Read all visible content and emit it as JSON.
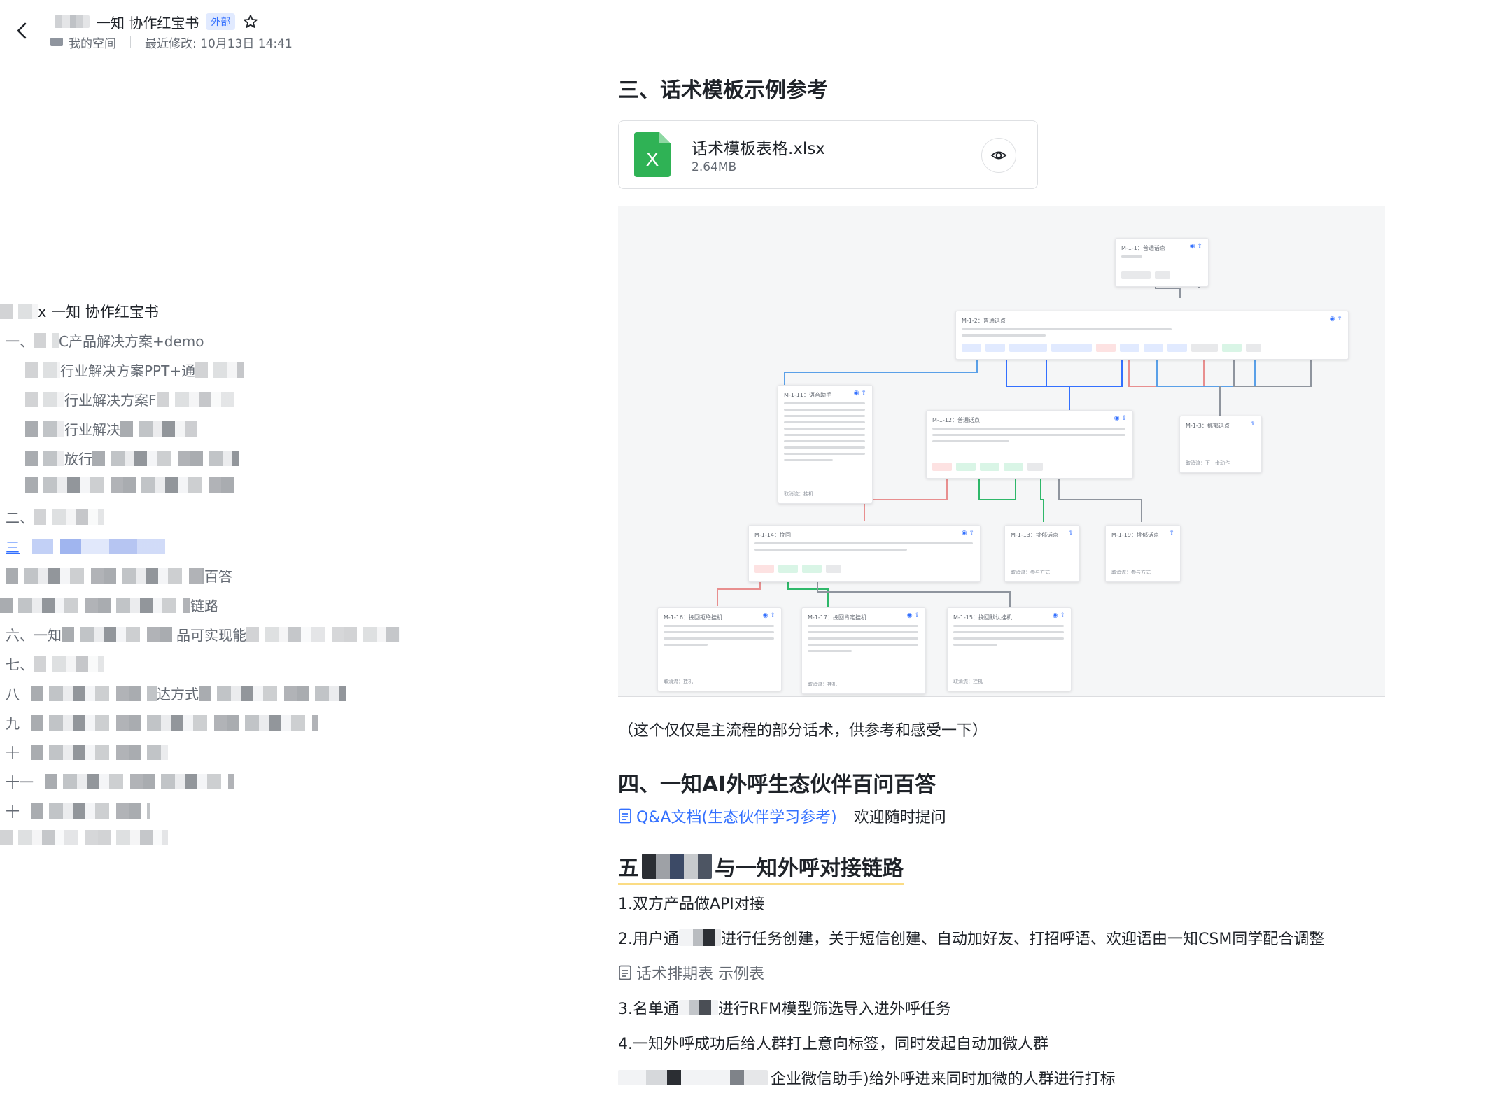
{
  "header": {
    "title": "一知 协作红宝书",
    "badge": "外部",
    "space": "我的空间",
    "modified": "最近修改: 10月13日 14:41"
  },
  "outline": {
    "title": "x 一知 协作红宝书",
    "items": [
      {
        "text": "一、"
      },
      {
        "text": "C产品解决方案+demo"
      },
      {
        "text": "行业解决方案PPT+通"
      },
      {
        "text": "行业解决方案F"
      },
      {
        "text": "行业解决"
      },
      {
        "text": "放行"
      },
      {
        "text": "二、"
      },
      {
        "text": "三"
      },
      {
        "text": "百答"
      },
      {
        "text": "链路"
      },
      {
        "text": "六、一知"
      },
      {
        "text": "品可实现能"
      },
      {
        "text": "七、"
      },
      {
        "text": "八"
      },
      {
        "text": "达方式"
      },
      {
        "text": "九"
      },
      {
        "text": "十"
      },
      {
        "text": "十一"
      },
      {
        "text": "十"
      }
    ]
  },
  "doc": {
    "section3_title": "三、话术模板示例参考",
    "file": {
      "name": "话术模板表格.xlsx",
      "size": "2.64MB",
      "icon_letter": "X"
    },
    "flow_nodes": [
      {
        "title": "M-1-1：普通话点",
        "foot": ""
      },
      {
        "title": "M-1-2：普通话点",
        "foot": ""
      },
      {
        "title": "M-1-11：语音助手",
        "foot": "取消流：挂机"
      },
      {
        "title": "M-1-12：普通话点",
        "foot": ""
      },
      {
        "title": "M-1-3：挑郁话点",
        "foot": "取消流：下一步动作"
      },
      {
        "title": "M-1-14：挽回",
        "foot": ""
      },
      {
        "title": "M-1-13：挑郁话点",
        "foot": "取消流：参与方式"
      },
      {
        "title": "M-1-19：挑郁话点",
        "foot": "取消流：参与方式"
      },
      {
        "title": "M-1-16：挽回拒绝挂机",
        "foot": "取消流：挂机"
      },
      {
        "title": "M-1-17：挽回肯定挂机",
        "foot": "取消流：挂机"
      },
      {
        "title": "M-1-15：挽回默认挂机",
        "foot": "取消流：挂机"
      }
    ],
    "flow_caption": "（这个仅仅是主流程的部分话术，供参考和感受一下）",
    "section4_title": "四、一知AI外呼生态伙伴百问百答",
    "qa_link": "Q&A文档(生态伙伴学习参考)",
    "qa_suffix": "欢迎随时提问",
    "section5_prefix": "五",
    "section5_title": "与一知外呼对接链路",
    "step1": "1.双方产品做API对接",
    "step2_a": "2.用户通",
    "step2_b": "进行任务创建，关于短信创建、自动加好友、打招呼语、欢迎语由一知CSM同学配合调整",
    "sheet_link": "话术排期表 示例表",
    "step3_a": "3.名单通",
    "step3_b": "进行RFM模型筛选导入进外呼任务",
    "step4": "4.一知外呼成功后给人群打上意向标签，同时发起自动加微人群",
    "step5_b": "企业微信助手)给外呼进来同时加微的人群进行打标"
  }
}
